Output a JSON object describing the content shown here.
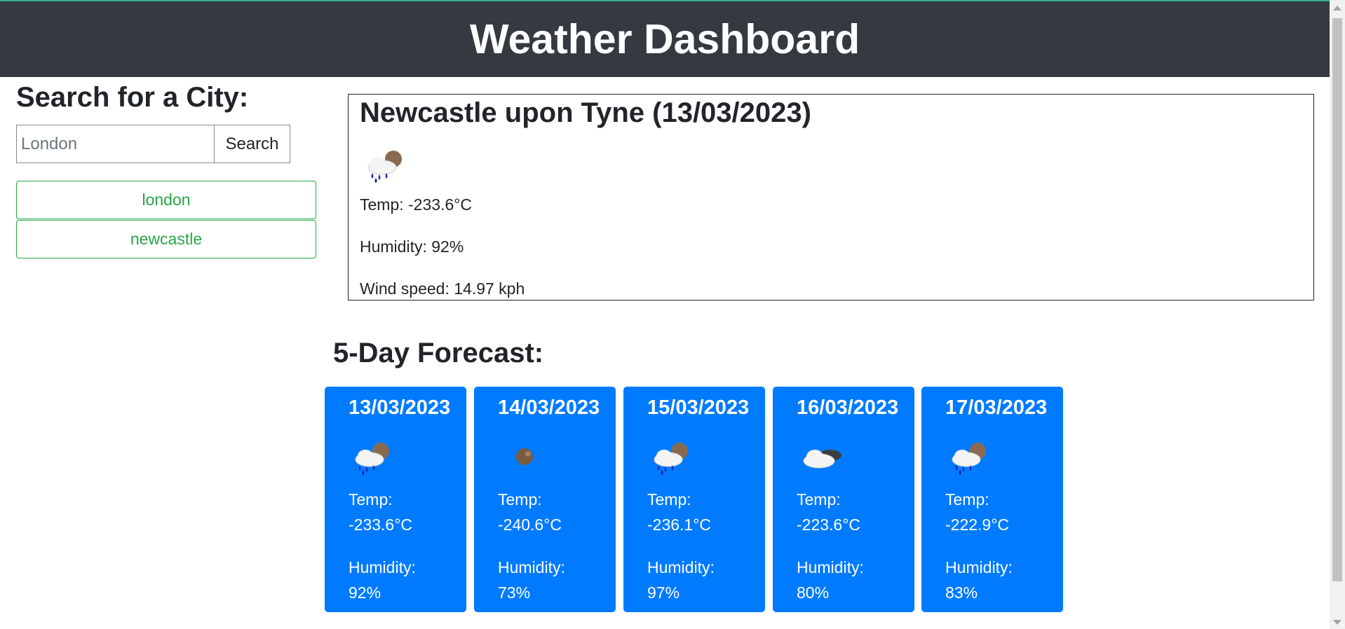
{
  "header": {
    "title": "Weather Dashboard"
  },
  "search": {
    "heading": "Search for a City:",
    "placeholder": "London",
    "button_label": "Search",
    "history": [
      "london",
      "newcastle"
    ]
  },
  "current": {
    "title": "Newcastle upon Tyne (13/03/2023)",
    "icon": "rain-cloud-icon",
    "temp": "Temp: -233.6°C",
    "humidity": "Humidity: 92%",
    "wind": "Wind speed: 14.97 kph"
  },
  "forecast": {
    "heading": "5-Day Forecast:",
    "temp_label": "Temp:",
    "humidity_label": "Humidity:",
    "days": [
      {
        "date": "13/03/2023",
        "icon": "rain-cloud-icon",
        "temp": "-233.6°C",
        "humidity": "92%"
      },
      {
        "date": "14/03/2023",
        "icon": "moon-icon",
        "temp": "-240.6°C",
        "humidity": "73%"
      },
      {
        "date": "15/03/2023",
        "icon": "rain-cloud-icon",
        "temp": "-236.1°C",
        "humidity": "97%"
      },
      {
        "date": "16/03/2023",
        "icon": "cloudy-icon",
        "temp": "-223.6°C",
        "humidity": "80%"
      },
      {
        "date": "17/03/2023",
        "icon": "rain-cloud-icon",
        "temp": "-222.9°C",
        "humidity": "83%"
      }
    ]
  },
  "colors": {
    "header_bg": "#343a40",
    "card_bg": "#007bff",
    "history_green": "#28a745"
  }
}
